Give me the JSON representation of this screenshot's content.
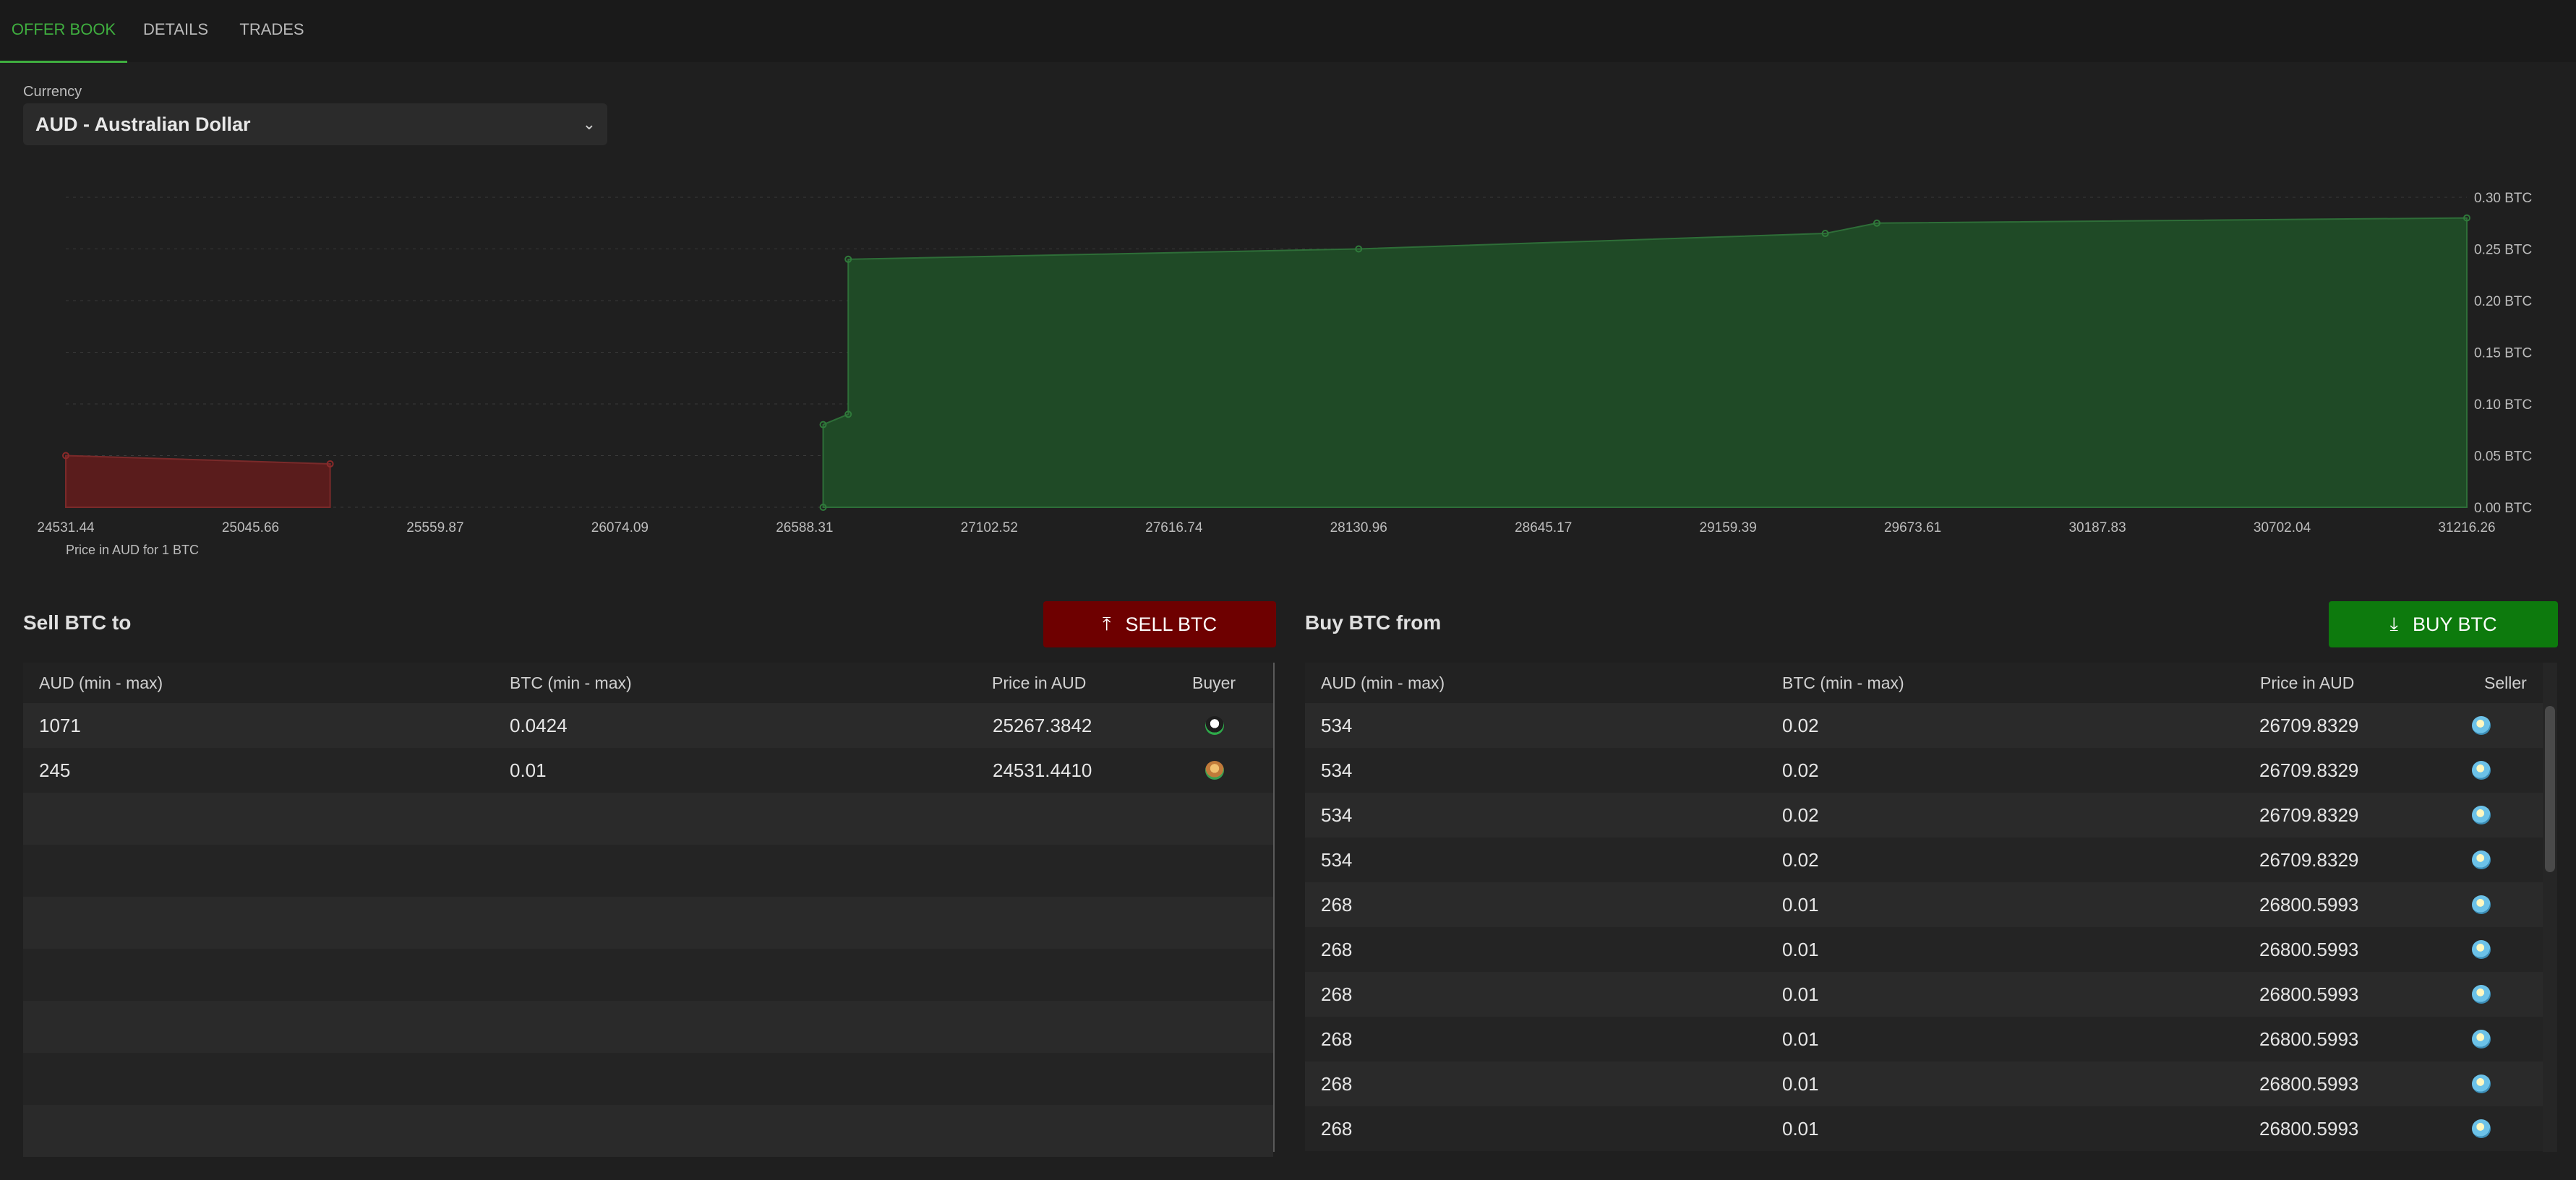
{
  "tabs": [
    "OFFER BOOK",
    "DETAILS",
    "TRADES"
  ],
  "currency": {
    "label": "Currency",
    "selected": "AUD  -  Australian Dollar"
  },
  "colors": {
    "accent": "#3fae3f",
    "sell": "#6e0000",
    "buy": "#0d7a0d",
    "buy_area": "#1f4a26",
    "sell_area": "#5a1c1c"
  },
  "chart_data": {
    "type": "area",
    "xlabel": "Price in AUD for 1 BTC",
    "xlim": [
      24531.44,
      31216.26
    ],
    "ylim": [
      0,
      0.3
    ],
    "x_ticks": [
      "24531.44",
      "25045.66",
      "25559.87",
      "26074.09",
      "26588.31",
      "27102.52",
      "27616.74",
      "28130.96",
      "28645.17",
      "29159.39",
      "29673.61",
      "30187.83",
      "30702.04",
      "31216.26"
    ],
    "y_ticks": [
      "0.00 BTC",
      "0.05 BTC",
      "0.10 BTC",
      "0.15 BTC",
      "0.20 BTC",
      "0.25 BTC",
      "0.30 BTC"
    ],
    "series": [
      {
        "side": "buy",
        "points": [
          [
            24531.44,
            0.05
          ],
          [
            25267.38,
            0.042
          ]
        ]
      },
      {
        "side": "sell",
        "points": [
          [
            26640,
            0.0
          ],
          [
            26640,
            0.08
          ],
          [
            26709.83,
            0.09
          ],
          [
            26709.83,
            0.24
          ],
          [
            28130.96,
            0.25
          ],
          [
            29430,
            0.265
          ],
          [
            29573.7,
            0.275
          ],
          [
            31216.26,
            0.28
          ]
        ]
      }
    ],
    "grid": true
  },
  "sell_section": {
    "title": "Sell BTC to",
    "button": "SELL BTC",
    "columns": [
      "AUD (min - max)",
      "BTC (min - max)",
      "Price in AUD",
      "Buyer"
    ],
    "rows": [
      {
        "aud": "1071",
        "btc": "0.0424",
        "price": "25267.3842",
        "avatar": "buyer-avatar-1"
      },
      {
        "aud": "245",
        "btc": "0.01",
        "price": "24531.4410",
        "avatar": "buyer-avatar-2"
      }
    ]
  },
  "buy_section": {
    "title": "Buy BTC from",
    "button": "BUY BTC",
    "columns": [
      "AUD (min - max)",
      "BTC (min - max)",
      "Price in AUD",
      "Seller"
    ],
    "rows": [
      {
        "aud": "534",
        "btc": "0.02",
        "price": "26709.8329"
      },
      {
        "aud": "534",
        "btc": "0.02",
        "price": "26709.8329"
      },
      {
        "aud": "534",
        "btc": "0.02",
        "price": "26709.8329"
      },
      {
        "aud": "534",
        "btc": "0.02",
        "price": "26709.8329"
      },
      {
        "aud": "268",
        "btc": "0.01",
        "price": "26800.5993"
      },
      {
        "aud": "268",
        "btc": "0.01",
        "price": "26800.5993"
      },
      {
        "aud": "268",
        "btc": "0.01",
        "price": "26800.5993"
      },
      {
        "aud": "268",
        "btc": "0.01",
        "price": "26800.5993"
      },
      {
        "aud": "268",
        "btc": "0.01",
        "price": "26800.5993"
      },
      {
        "aud": "268",
        "btc": "0.01",
        "price": "26800.5993"
      }
    ]
  }
}
